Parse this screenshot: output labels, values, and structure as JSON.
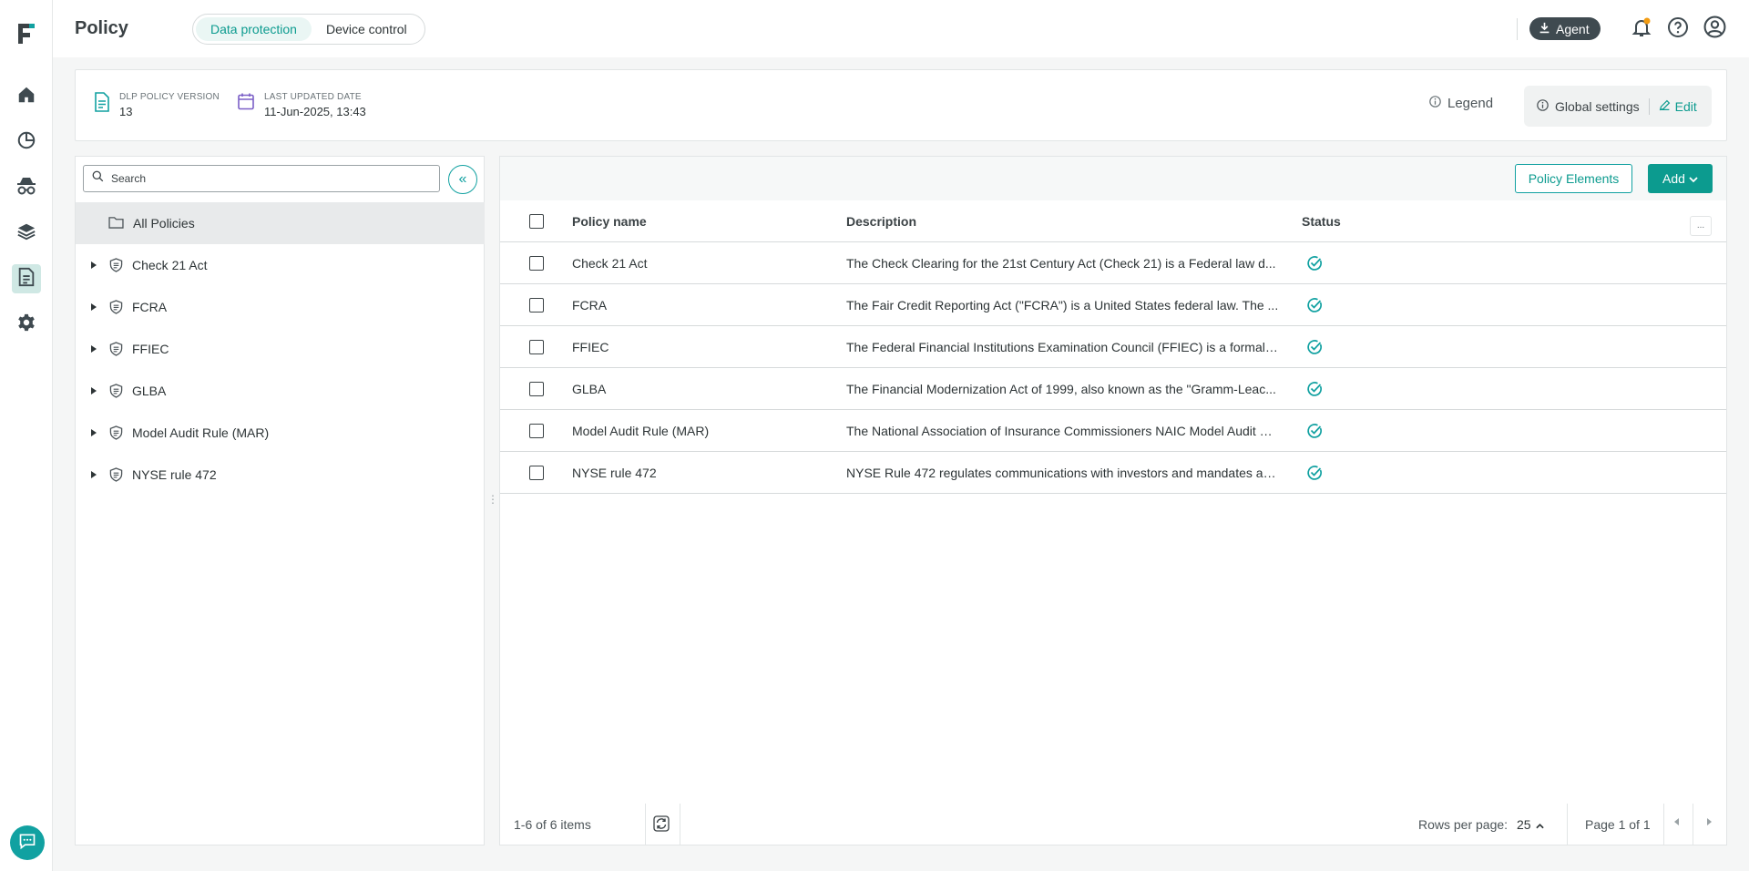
{
  "header": {
    "title": "Policy",
    "tabs": [
      {
        "label": "Data protection",
        "active": true
      },
      {
        "label": "Device control",
        "active": false
      }
    ],
    "agent_label": "Agent"
  },
  "rail": {
    "items": [
      "home-icon",
      "pie-chart-icon",
      "spy-icon",
      "layers-icon",
      "policy-document-icon",
      "gear-icon"
    ],
    "active": "policy-document-icon",
    "chat": "chat-icon"
  },
  "info": {
    "policy_version_label": "DLP POLICY VERSION",
    "policy_version_value": "13",
    "updated_label": "LAST UPDATED DATE",
    "updated_value": "11-Jun-2025, 13:43",
    "legend_label": "Legend",
    "global_settings_label": "Global settings",
    "edit_label": "Edit"
  },
  "tree": {
    "search_placeholder": "Search",
    "collapse_glyph": "«",
    "all_label": "All Policies",
    "items": [
      {
        "label": "Check 21 Act"
      },
      {
        "label": "FCRA"
      },
      {
        "label": "FFIEC"
      },
      {
        "label": "GLBA"
      },
      {
        "label": "Model Audit Rule (MAR)"
      },
      {
        "label": "NYSE rule 472"
      }
    ]
  },
  "table": {
    "policy_elements_label": "Policy Elements",
    "add_label": "Add",
    "more_label": "...",
    "columns": {
      "name": "Policy name",
      "description": "Description",
      "status": "Status"
    },
    "rows": [
      {
        "name": "Check 21 Act",
        "description": "The Check Clearing for the 21st Century Act (Check 21) is a Federal law d...",
        "status": "enabled"
      },
      {
        "name": "FCRA",
        "description": "The Fair Credit Reporting Act (\"FCRA\") is a United States federal law. The ...",
        "status": "enabled"
      },
      {
        "name": "FFIEC",
        "description": "The Federal Financial Institutions Examination Council (FFIEC) is a formal i...",
        "status": "enabled"
      },
      {
        "name": "GLBA",
        "description": "The Financial Modernization Act of 1999, also known as the \"Gramm-Leac...",
        "status": "enabled"
      },
      {
        "name": "Model Audit Rule (MAR)",
        "description": "The National Association of Insurance Commissioners NAIC Model Audit R...",
        "status": "enabled"
      },
      {
        "name": "NYSE rule 472",
        "description": "NYSE Rule 472 regulates communications with investors and mandates ap...",
        "status": "enabled"
      }
    ],
    "footer": {
      "items_text": "1-6 of 6 items",
      "rows_per_page_label": "Rows per page:",
      "rows_per_page_value": "25",
      "page_text": "Page 1 of 1"
    }
  },
  "colors": {
    "accent": "#0c9b8f",
    "agent_bg": "#3f4a50",
    "notification_dot": "#f39c12"
  }
}
